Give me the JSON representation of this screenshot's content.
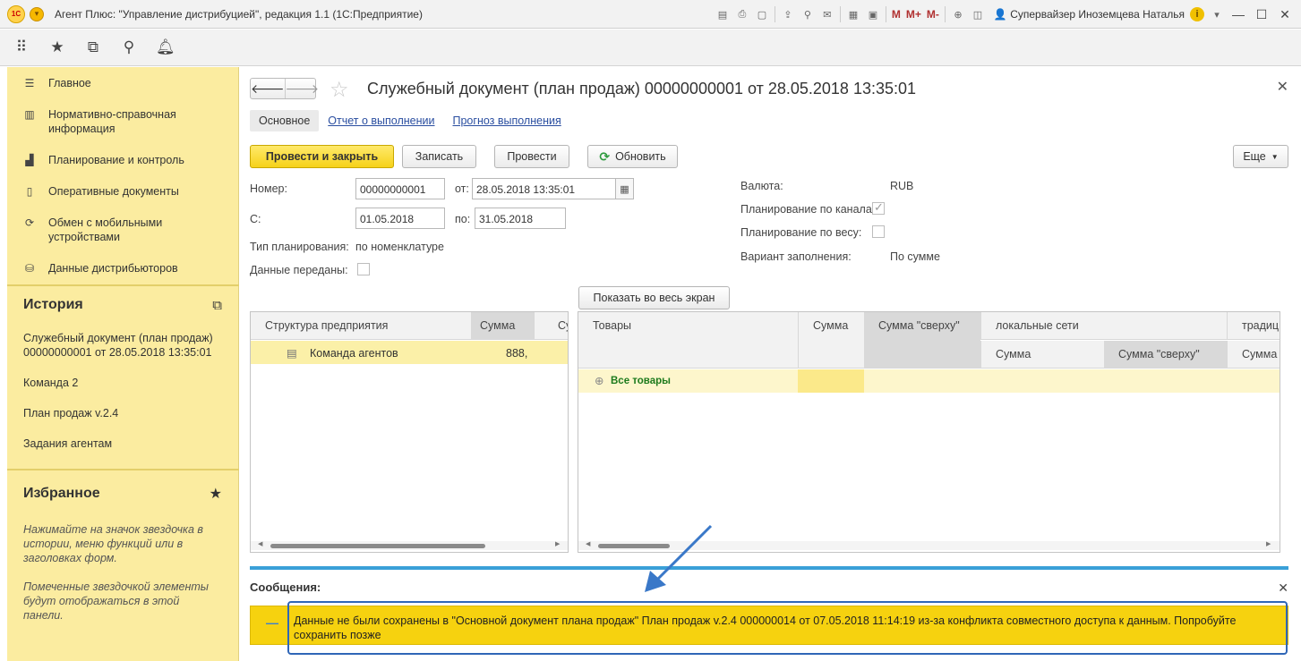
{
  "titlebar": {
    "logo": "1С",
    "title": "Агент Плюс: \"Управление дистрибуцией\", редакция 1.1  (1С:Предприятие)",
    "m1": "M",
    "m2": "M+",
    "m3": "M-",
    "user": "Супервайзер Иноземцева Наталья"
  },
  "sidebar": {
    "sections": [
      {
        "label": "Главное",
        "icon": "menu-icon"
      },
      {
        "label": "Нормативно-справочная информация",
        "icon": "catalog-icon"
      },
      {
        "label": "Планирование и контроль",
        "icon": "chart-icon"
      },
      {
        "label": "Оперативные документы",
        "icon": "documents-icon"
      },
      {
        "label": "Обмен с мобильными устройствами",
        "icon": "sync-icon"
      },
      {
        "label": "Данные дистрибьюторов",
        "icon": "database-icon"
      }
    ],
    "history": {
      "title": "История",
      "items": [
        "Служебный документ (план продаж) 00000000001 от 28.05.2018 13:35:01",
        "Команда 2",
        "План продаж v.2.4",
        "Задания агентам"
      ]
    },
    "favorites": {
      "title": "Избранное",
      "hint1": "Нажимайте на значок звездочка в истории, меню функций или в заголовках форм.",
      "hint2": "Помеченные звездочкой элементы будут отображаться в этой панели."
    }
  },
  "document": {
    "title": "Служебный документ (план продаж) 00000000001 от 28.05.2018 13:35:01",
    "tabs": [
      "Основное",
      "Отчет о выполнении",
      "Прогноз выполнения"
    ],
    "buttons": {
      "post_close": "Провести и закрыть",
      "save": "Записать",
      "post": "Провести",
      "refresh": "Обновить",
      "more": "Еще",
      "fullscreen": "Показать во весь экран"
    },
    "fields": {
      "number_label": "Номер:",
      "number_value": "00000000001",
      "from_label": "от:",
      "from_value": "28.05.2018 13:35:01",
      "period_from_label": "С:",
      "period_from_value": "01.05.2018",
      "period_to_label": "по:",
      "period_to_value": "31.05.2018",
      "plan_type_label": "Тип планирования:",
      "plan_type_value": "по номенклатуре",
      "data_sent_label": "Данные переданы:",
      "currency_label": "Валюта:",
      "currency_value": "RUB",
      "by_channels_label": "Планирование по каналам:",
      "by_weight_label": "Планирование по весу:",
      "fill_variant_label": "Вариант заполнения:",
      "fill_variant_value": "По сумме"
    },
    "left_table": {
      "columns": [
        "Структура предприятия",
        "Сумма",
        "Су"
      ],
      "rows": [
        {
          "name": "Команда агентов",
          "sum": "888,"
        }
      ]
    },
    "right_table": {
      "columns": [
        "Товары",
        "Сумма",
        "Сумма \"сверху\"",
        "локальные сети",
        "традиц"
      ],
      "subcolumns": [
        "Сумма",
        "Сумма \"сверху\"",
        "Сумма"
      ],
      "rows": [
        {
          "name": "Все товары"
        }
      ]
    },
    "messages": {
      "title": "Сообщения:",
      "text": "Данные не были сохранены в \"Основной документ плана продаж\" План продаж v.2.4 000000014 от 07.05.2018 11:14:19 из-за конфликта совместного доступа к данным. Попробуйте сохранить позже"
    }
  }
}
